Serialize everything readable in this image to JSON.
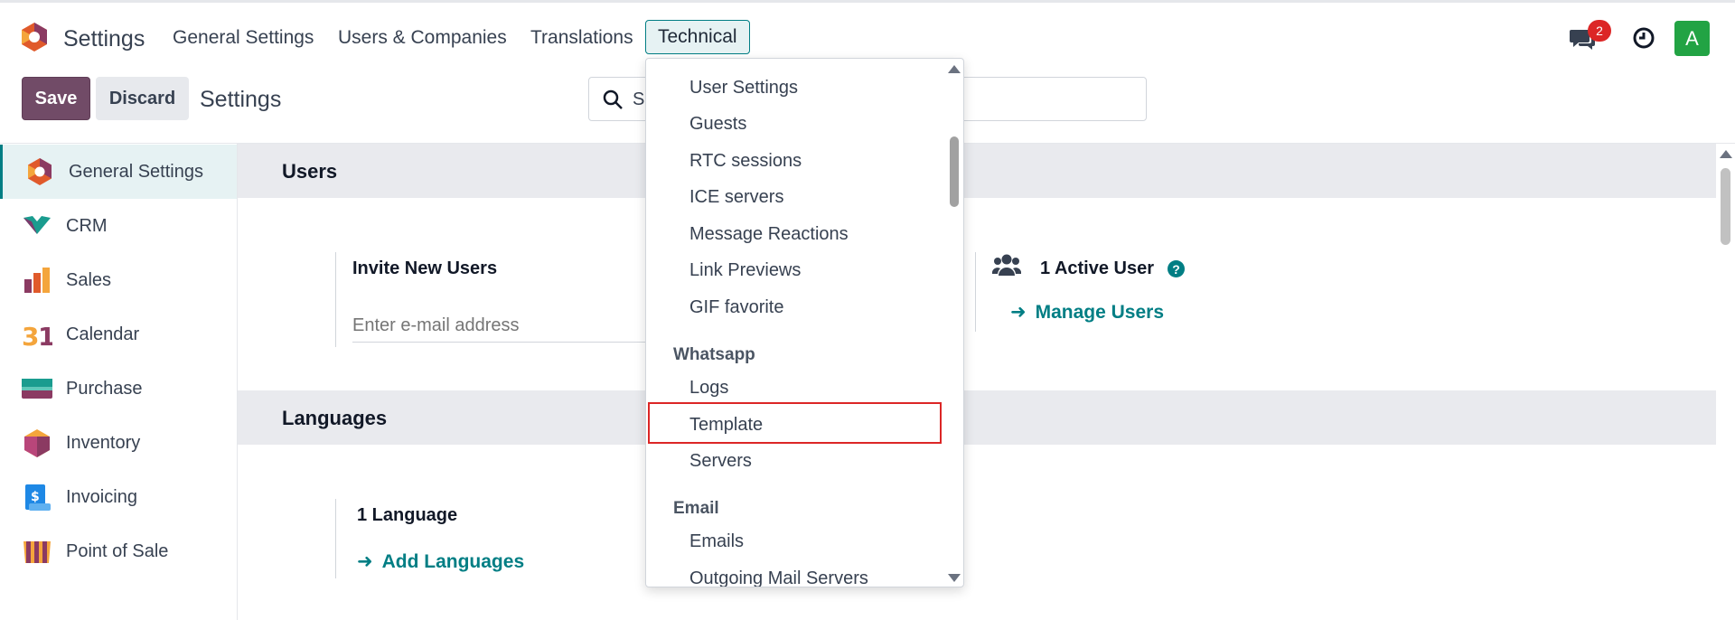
{
  "navbar": {
    "app_name": "Settings",
    "menu": [
      "General Settings",
      "Users & Companies",
      "Translations",
      "Technical"
    ],
    "messages_badge": "2",
    "avatar_letter": "A"
  },
  "control_panel": {
    "save_label": "Save",
    "discard_label": "Discard",
    "title": "Settings",
    "search_value": "S"
  },
  "sidebar": {
    "items": [
      {
        "label": "General Settings",
        "icon": "settings-app-icon",
        "active": true
      },
      {
        "label": "CRM",
        "icon": "crm-app-icon"
      },
      {
        "label": "Sales",
        "icon": "sales-app-icon"
      },
      {
        "label": "Calendar",
        "icon": "calendar-app-icon"
      },
      {
        "label": "Purchase",
        "icon": "purchase-app-icon"
      },
      {
        "label": "Inventory",
        "icon": "inventory-app-icon"
      },
      {
        "label": "Invoicing",
        "icon": "invoicing-app-icon"
      },
      {
        "label": "Point of Sale",
        "icon": "pos-app-icon"
      }
    ]
  },
  "main": {
    "users_section": {
      "title": "Users",
      "invite_title": "Invite New Users",
      "email_placeholder": "Enter e-mail address",
      "active_users": "1 Active User",
      "manage_users": "Manage Users"
    },
    "languages_section": {
      "title": "Languages",
      "count": "1 Language",
      "add_languages": "Add Languages"
    }
  },
  "dropdown": {
    "items_top": [
      "User Settings",
      "Guests",
      "RTC sessions",
      "ICE servers",
      "Message Reactions",
      "Link Previews",
      "GIF favorite"
    ],
    "whatsapp_header": "Whatsapp",
    "whatsapp_items": [
      "Logs",
      "Template",
      "Servers"
    ],
    "email_header": "Email",
    "email_items": [
      "Emails",
      "Outgoing Mail Servers"
    ],
    "highlighted": "Template"
  },
  "colors": {
    "brand": "#714b67",
    "accent": "#017e84",
    "highlight_border": "#dc2626"
  }
}
